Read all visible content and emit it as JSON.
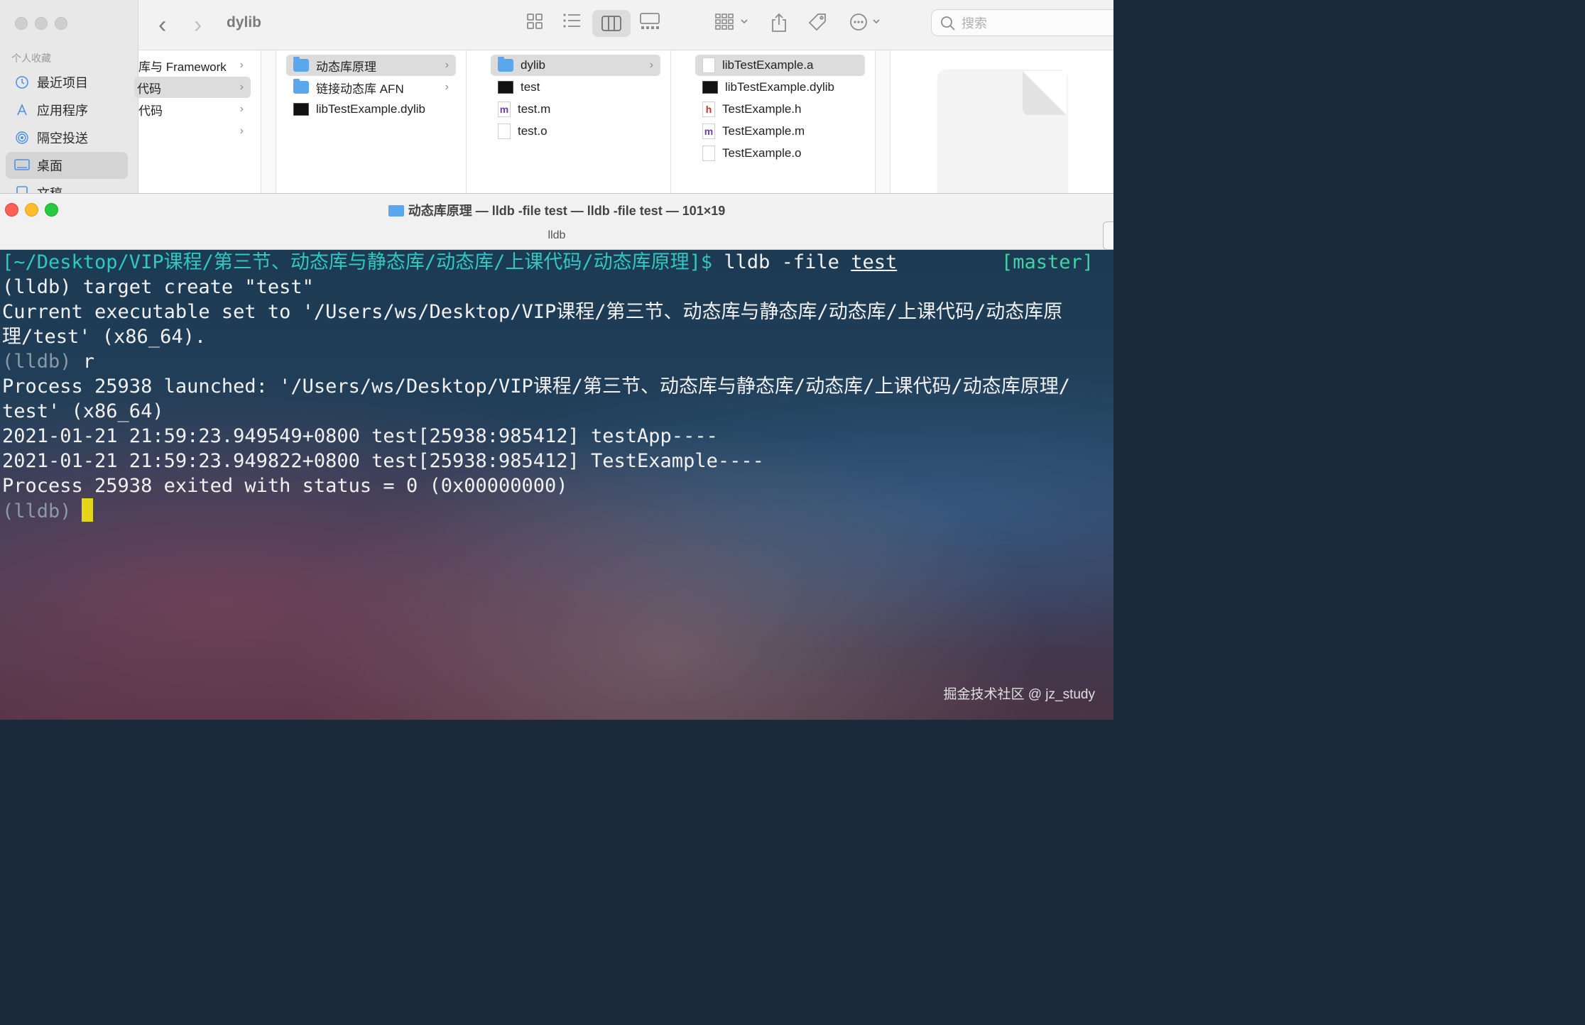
{
  "finder": {
    "title": "dylib",
    "sidebar": {
      "section_label": "个人收藏",
      "items": [
        {
          "label": "最近项目",
          "icon": "clock-icon"
        },
        {
          "label": "应用程序",
          "icon": "applications-icon"
        },
        {
          "label": "隔空投送",
          "icon": "airdrop-icon"
        },
        {
          "label": "桌面",
          "icon": "desktop-icon",
          "selected": true
        },
        {
          "label": "文稿",
          "icon": "document-icon"
        }
      ]
    },
    "toolbar": {
      "back": "‹",
      "forward": "›",
      "search_placeholder": "搜索"
    },
    "columns": [
      {
        "items": [
          {
            "label": "库与 Framework",
            "type": "folder"
          },
          {
            "label": "代码",
            "type": "folder",
            "selected": true
          },
          {
            "label": "代码",
            "type": "folder"
          },
          {
            "label": "",
            "type": "folder"
          }
        ]
      },
      {
        "items": [
          {
            "label": "动态库原理",
            "type": "folder",
            "selected": true
          },
          {
            "label": "链接动态库 AFN",
            "type": "folder"
          },
          {
            "label": "libTestExample.dylib",
            "type": "exec"
          }
        ]
      },
      {
        "items": [
          {
            "label": "dylib",
            "type": "folder",
            "selected": true
          },
          {
            "label": "test",
            "type": "exec"
          },
          {
            "label": "test.m",
            "type": "source",
            "badge": "m"
          },
          {
            "label": "test.o",
            "type": "doc"
          }
        ]
      },
      {
        "items": [
          {
            "label": "libTestExample.a",
            "type": "doc",
            "selected": true
          },
          {
            "label": "libTestExample.dylib",
            "type": "exec"
          },
          {
            "label": "TestExample.h",
            "type": "source",
            "badge": "h"
          },
          {
            "label": "TestExample.m",
            "type": "source",
            "badge": "m"
          },
          {
            "label": "TestExample.o",
            "type": "doc"
          }
        ]
      }
    ]
  },
  "terminal": {
    "title": "动态库原理 — lldb -file test — lldb -file test — 101×19",
    "tab_label": "lldb",
    "prompt_path": "[~/Desktop/VIP课程/第三节、动态库与静态库/动态库/上课代码/动态库原理]$",
    "command": " lldb -file ",
    "command_arg": "test",
    "git_branch": "[master]",
    "lines": [
      "(lldb) target create \"test\"",
      "Current executable set to '/Users/ws/Desktop/VIP课程/第三节、动态库与静态库/动态库/上课代码/动态库原",
      "理/test' (x86_64).",
      "",
      "Process 25938 launched: '/Users/ws/Desktop/VIP课程/第三节、动态库与静态库/动态库/上课代码/动态库原理/",
      "test' (x86_64)",
      "2021-01-21 21:59:23.949549+0800 test[25938:985412] testApp----",
      "2021-01-21 21:59:23.949822+0800 test[25938:985412] TestExample----",
      "Process 25938 exited with status = 0 (0x00000000)"
    ],
    "prompt_dim": "(lldb)",
    "run_cmd": " r",
    "watermark": "掘金技术社区 @ jz_study",
    "colors": {
      "prompt": "#30c8c0",
      "cursor": "#e7d51a"
    }
  }
}
